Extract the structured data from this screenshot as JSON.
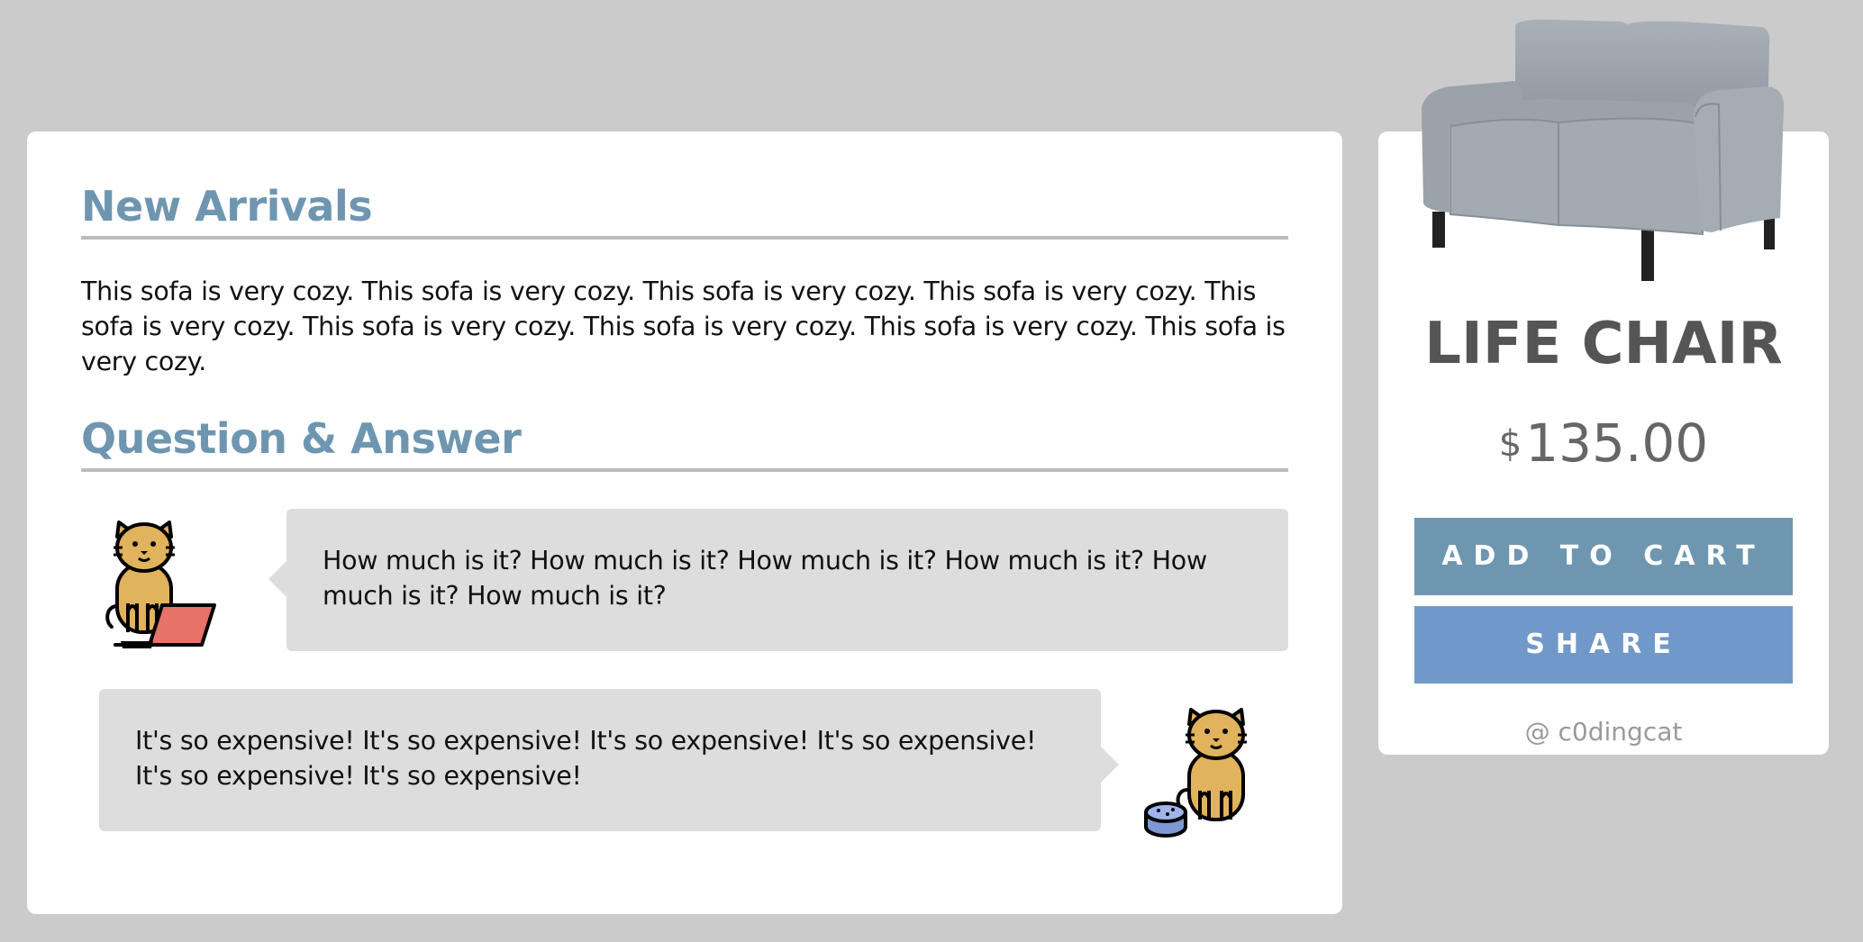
{
  "main": {
    "new_arrivals_title": "New Arrivals",
    "description": "This sofa is very cozy. This sofa is very cozy. This sofa is very cozy. This sofa is very cozy. This sofa is very cozy. This sofa is very cozy. This sofa is very cozy. This sofa is very cozy. This sofa is very cozy.",
    "qa_title": "Question & Answer",
    "question": "How much is it? How much is it? How much is it? How much is it? How much is it? How much is it?",
    "answer": "It's so expensive! It's so expensive! It's so expensive! It's so expensive! It's so expensive! It's so expensive!"
  },
  "product": {
    "name": "LIFE CHAIR",
    "currency": "$",
    "price": "135.00",
    "add_to_cart_label": "ADD TO CART",
    "share_label": "SHARE",
    "credit": "@ c0dingcat"
  },
  "icons": {
    "question_avatar": "cat-with-laptop-icon",
    "answer_avatar": "cat-with-food-bowl-icon",
    "product_image": "gray-sofa-image"
  },
  "colors": {
    "background": "#cbcbcb",
    "heading": "#6f96b0",
    "add_to_cart": "#6f96b0",
    "share": "#7099c9",
    "bubble": "#dddddd"
  }
}
